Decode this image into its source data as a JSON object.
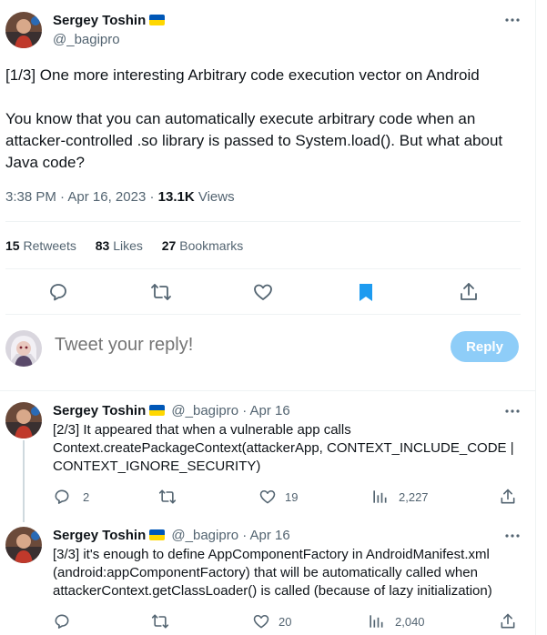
{
  "main_tweet": {
    "author_name": "Sergey Toshin",
    "handle": "@_bagipro",
    "paragraph1": "[1/3] One more interesting Arbitrary code execution vector on Android",
    "paragraph2": "You know that you can automatically execute arbitrary code when an attacker-controlled .so library is passed to System.load(). But what about Java code?",
    "time": "3:38 PM",
    "date": "Apr 16, 2023",
    "views_count": "13.1K",
    "views_label": "Views",
    "separator": "·",
    "retweets_count": "15",
    "retweets_label": "Retweets",
    "likes_count": "83",
    "likes_label": "Likes",
    "bookmarks_count": "27",
    "bookmarks_label": "Bookmarks"
  },
  "composer": {
    "placeholder": "Tweet your reply!",
    "reply_button": "Reply"
  },
  "replies": [
    {
      "author_name": "Sergey Toshin",
      "handle": "@_bagipro",
      "date": "Apr 16",
      "text": "[2/3] It appeared that when a vulnerable app calls Context.createPackageContext(attackerApp, CONTEXT_INCLUDE_CODE | CONTEXT_IGNORE_SECURITY)",
      "replies_count": "2",
      "retweets_count": "",
      "likes_count": "19",
      "views_count": "2,227"
    },
    {
      "author_name": "Sergey Toshin",
      "handle": "@_bagipro",
      "date": "Apr 16",
      "text": "[3/3] it's enough to define AppComponentFactory in AndroidManifest.xml (android:appComponentFactory) that will be automatically called when attackerContext.getClassLoader() is called (because of lazy initialization)",
      "replies_count": "",
      "retweets_count": "",
      "likes_count": "20",
      "views_count": "2,040"
    }
  ],
  "colors": {
    "text": "#0f1419",
    "muted": "#536471",
    "bookmark_active": "#1d9bf0",
    "reply_button_disabled": "#8ecdf8",
    "flag_blue": "#0057b7",
    "flag_yellow": "#ffd700"
  },
  "icons": {
    "more": "more-dots-icon",
    "reply": "reply-bubble-icon",
    "retweet": "retweet-icon",
    "like": "heart-icon",
    "bookmark": "bookmark-filled-icon",
    "share": "share-icon",
    "views": "analytics-bars-icon"
  }
}
